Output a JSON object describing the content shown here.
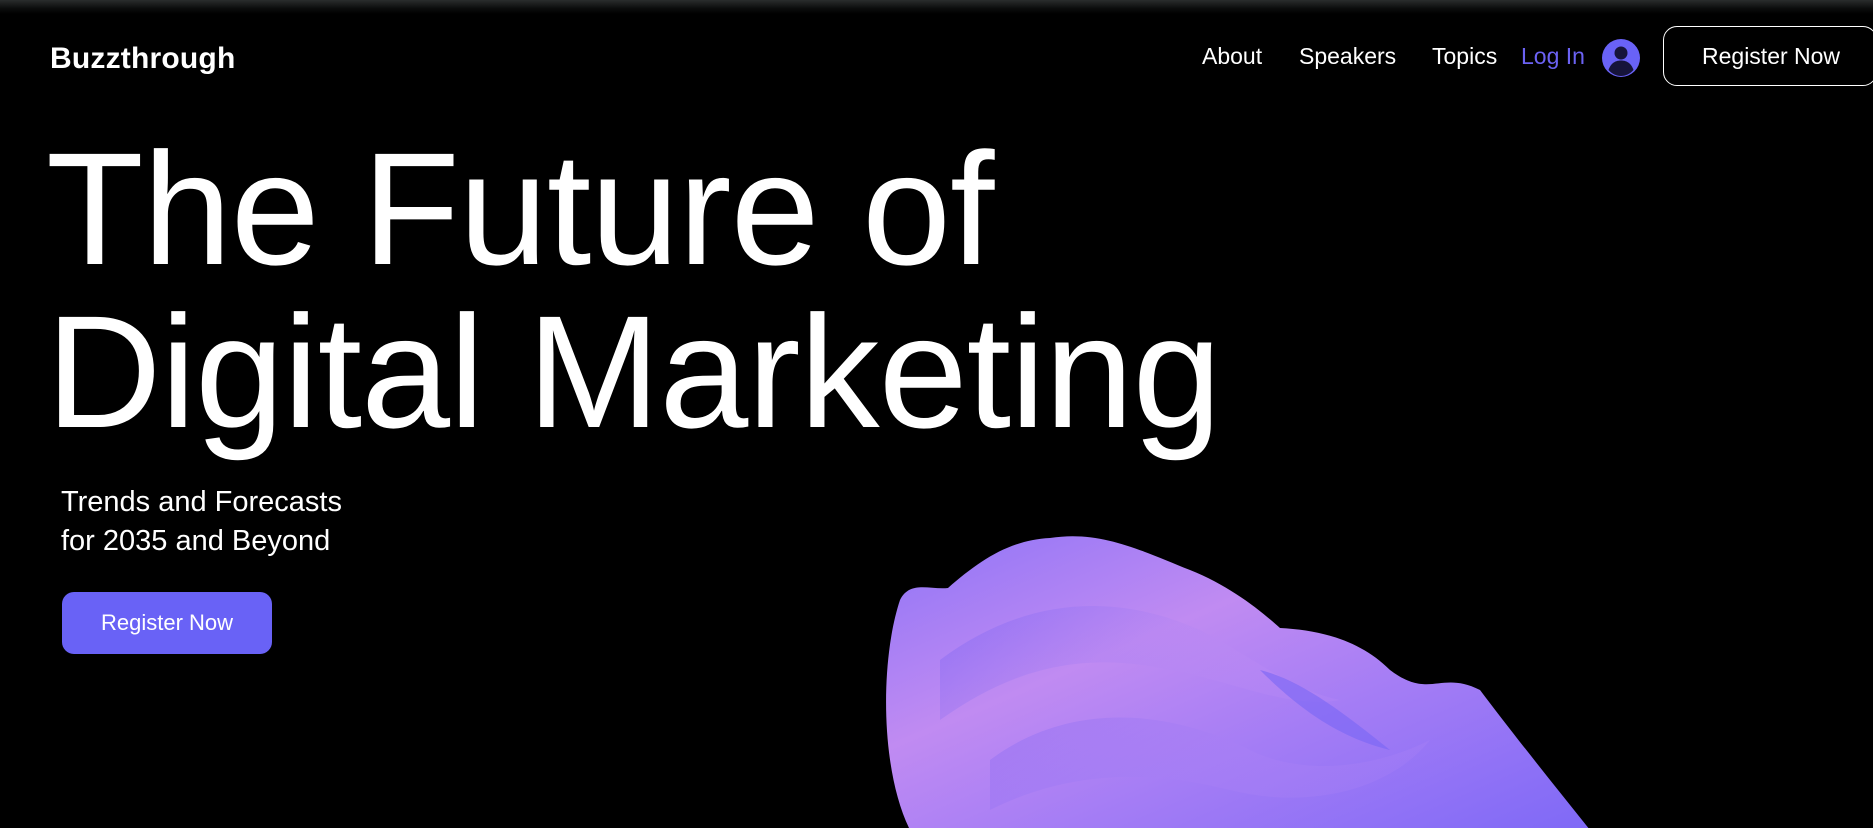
{
  "brand": {
    "name": "Buzzthrough"
  },
  "nav": {
    "items": [
      "About",
      "Speakers",
      "Topics"
    ],
    "login_label": "Log In",
    "register_label": "Register Now"
  },
  "hero": {
    "title_line1": "The Future of",
    "title_line2": "Digital Marketing",
    "subtitle_line1": "Trends and Forecasts",
    "subtitle_line2": "for 2035 and Beyond",
    "cta_label": "Register Now"
  },
  "colors": {
    "background": "#000000",
    "text": "#ffffff",
    "accent": "#6962f6",
    "login_link": "#6b62f3",
    "blob_light": "#c78af0",
    "blob_dark": "#7a66f6"
  },
  "icons": {
    "avatar": "user-avatar-icon"
  }
}
